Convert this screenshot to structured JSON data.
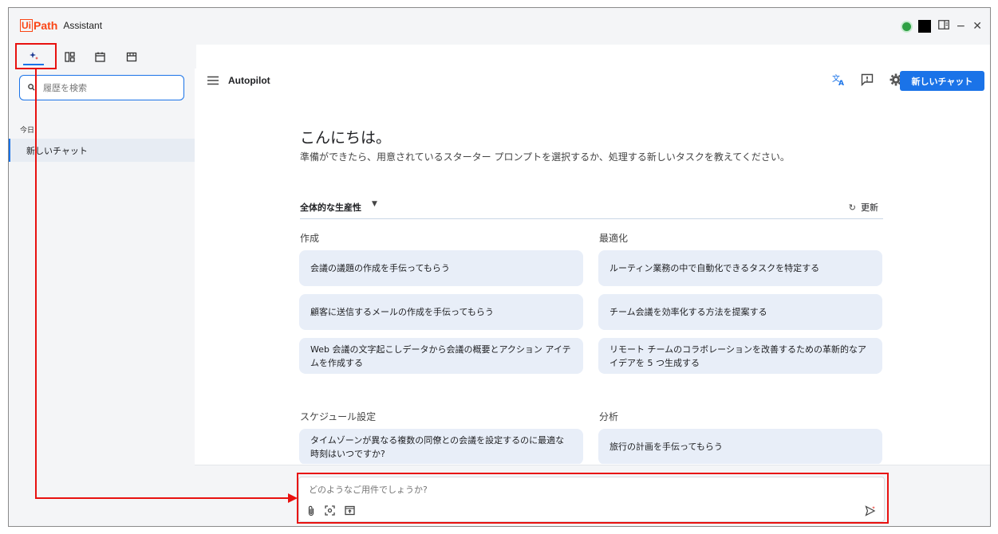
{
  "titlebar": {
    "logo_ui": "Ui",
    "logo_path": "Path",
    "app_name": "Assistant",
    "status_color": "#2ea043",
    "icons": [
      "status-dot",
      "black-square",
      "panel-icon",
      "minimize-icon",
      "close-icon"
    ],
    "minimize": "−",
    "close": "✕"
  },
  "nav": {
    "tabs": [
      {
        "name": "autopilot-sparkle-icon",
        "glyph": "✦",
        "active": true
      },
      {
        "name": "layout-icon",
        "glyph": "▥",
        "active": false
      },
      {
        "name": "calendar-icon",
        "glyph": "▭",
        "active": false
      },
      {
        "name": "store-icon",
        "glyph": "▤",
        "active": false
      }
    ]
  },
  "sidebar": {
    "search_placeholder": "履歴を検索",
    "section_today": "今日",
    "history": [
      {
        "label": "新しいチャット"
      }
    ]
  },
  "header": {
    "title": "Autopilot",
    "new_chat": "新しいチャット",
    "icons": [
      "translate-icon",
      "feedback-icon",
      "settings-icon"
    ]
  },
  "main": {
    "greeting": "こんにちは。",
    "subtext": "準備ができたら、用意されているスターター プロンプトを選択するか、処理する新しいタスクを教えてください。",
    "category": "全体的な生産性",
    "refresh": "更新",
    "columns": [
      {
        "title": "作成",
        "cards": [
          "会議の議題の作成を手伝ってもらう",
          "顧客に送信するメールの作成を手伝ってもらう",
          "Web 会議の文字起こしデータから会議の概要とアクション アイテムを作成する"
        ]
      },
      {
        "title": "最適化",
        "cards": [
          "ルーティン業務の中で自動化できるタスクを特定する",
          "チーム会議を効率化する方法を提案する",
          "リモート チームのコラボレーションを改善するための革新的なアイデアを 5 つ生成する"
        ]
      },
      {
        "title": "スケジュール設定",
        "cards": [
          "タイムゾーンが異なる複数の同僚との会議を設定するのに最適な時刻はいつですか?"
        ]
      },
      {
        "title": "分析",
        "cards": [
          "旅行の計画を手伝ってもらう"
        ]
      }
    ]
  },
  "composer": {
    "placeholder": "どのようなご用件でしょうか?",
    "icons": [
      "attach-icon",
      "screenshot-icon",
      "upload-icon",
      "send-sparkle-icon"
    ]
  },
  "annotation_color": "#e8110f"
}
